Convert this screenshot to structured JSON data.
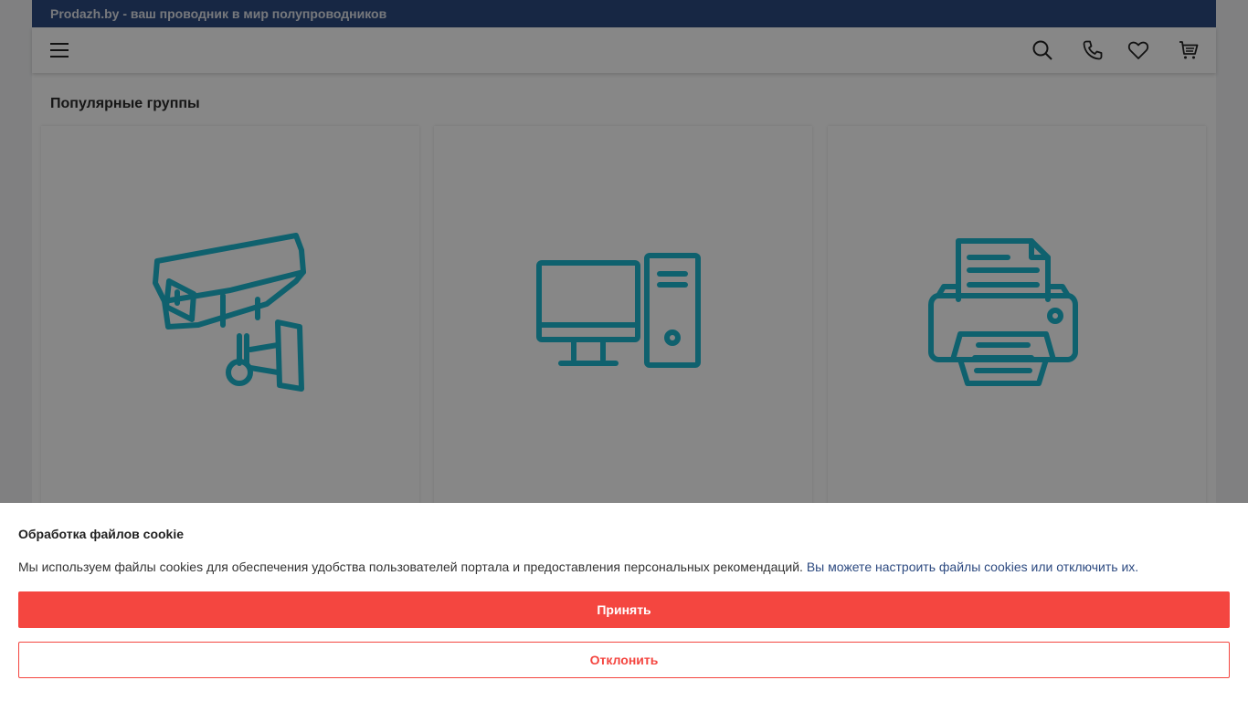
{
  "topbar": {
    "tagline": "Prodazh.by - ваш проводник в мир полупроводников"
  },
  "header": {
    "icons": [
      "menu-icon",
      "search-icon",
      "phone-icon",
      "heart-icon",
      "cart-icon"
    ]
  },
  "popular": {
    "title": "Популярные группы",
    "cards": [
      {
        "icon": "cctv-camera-icon"
      },
      {
        "icon": "desktop-computer-icon"
      },
      {
        "icon": "printer-icon"
      }
    ]
  },
  "cookie_banner": {
    "title": "Обработка файлов cookie",
    "text": "Мы используем файлы cookies для обеспечения удобства пользователей портала и предоставления персональных рекомендаций.",
    "link_text": "Вы можете настроить файлы cookies или отключить их.",
    "accept_label": "Принять",
    "decline_label": "Отклонить"
  },
  "colors": {
    "topbar": "#2d4a80",
    "accent": "#f44640",
    "icon": "#1eb8d0",
    "link": "#2d4a80"
  }
}
